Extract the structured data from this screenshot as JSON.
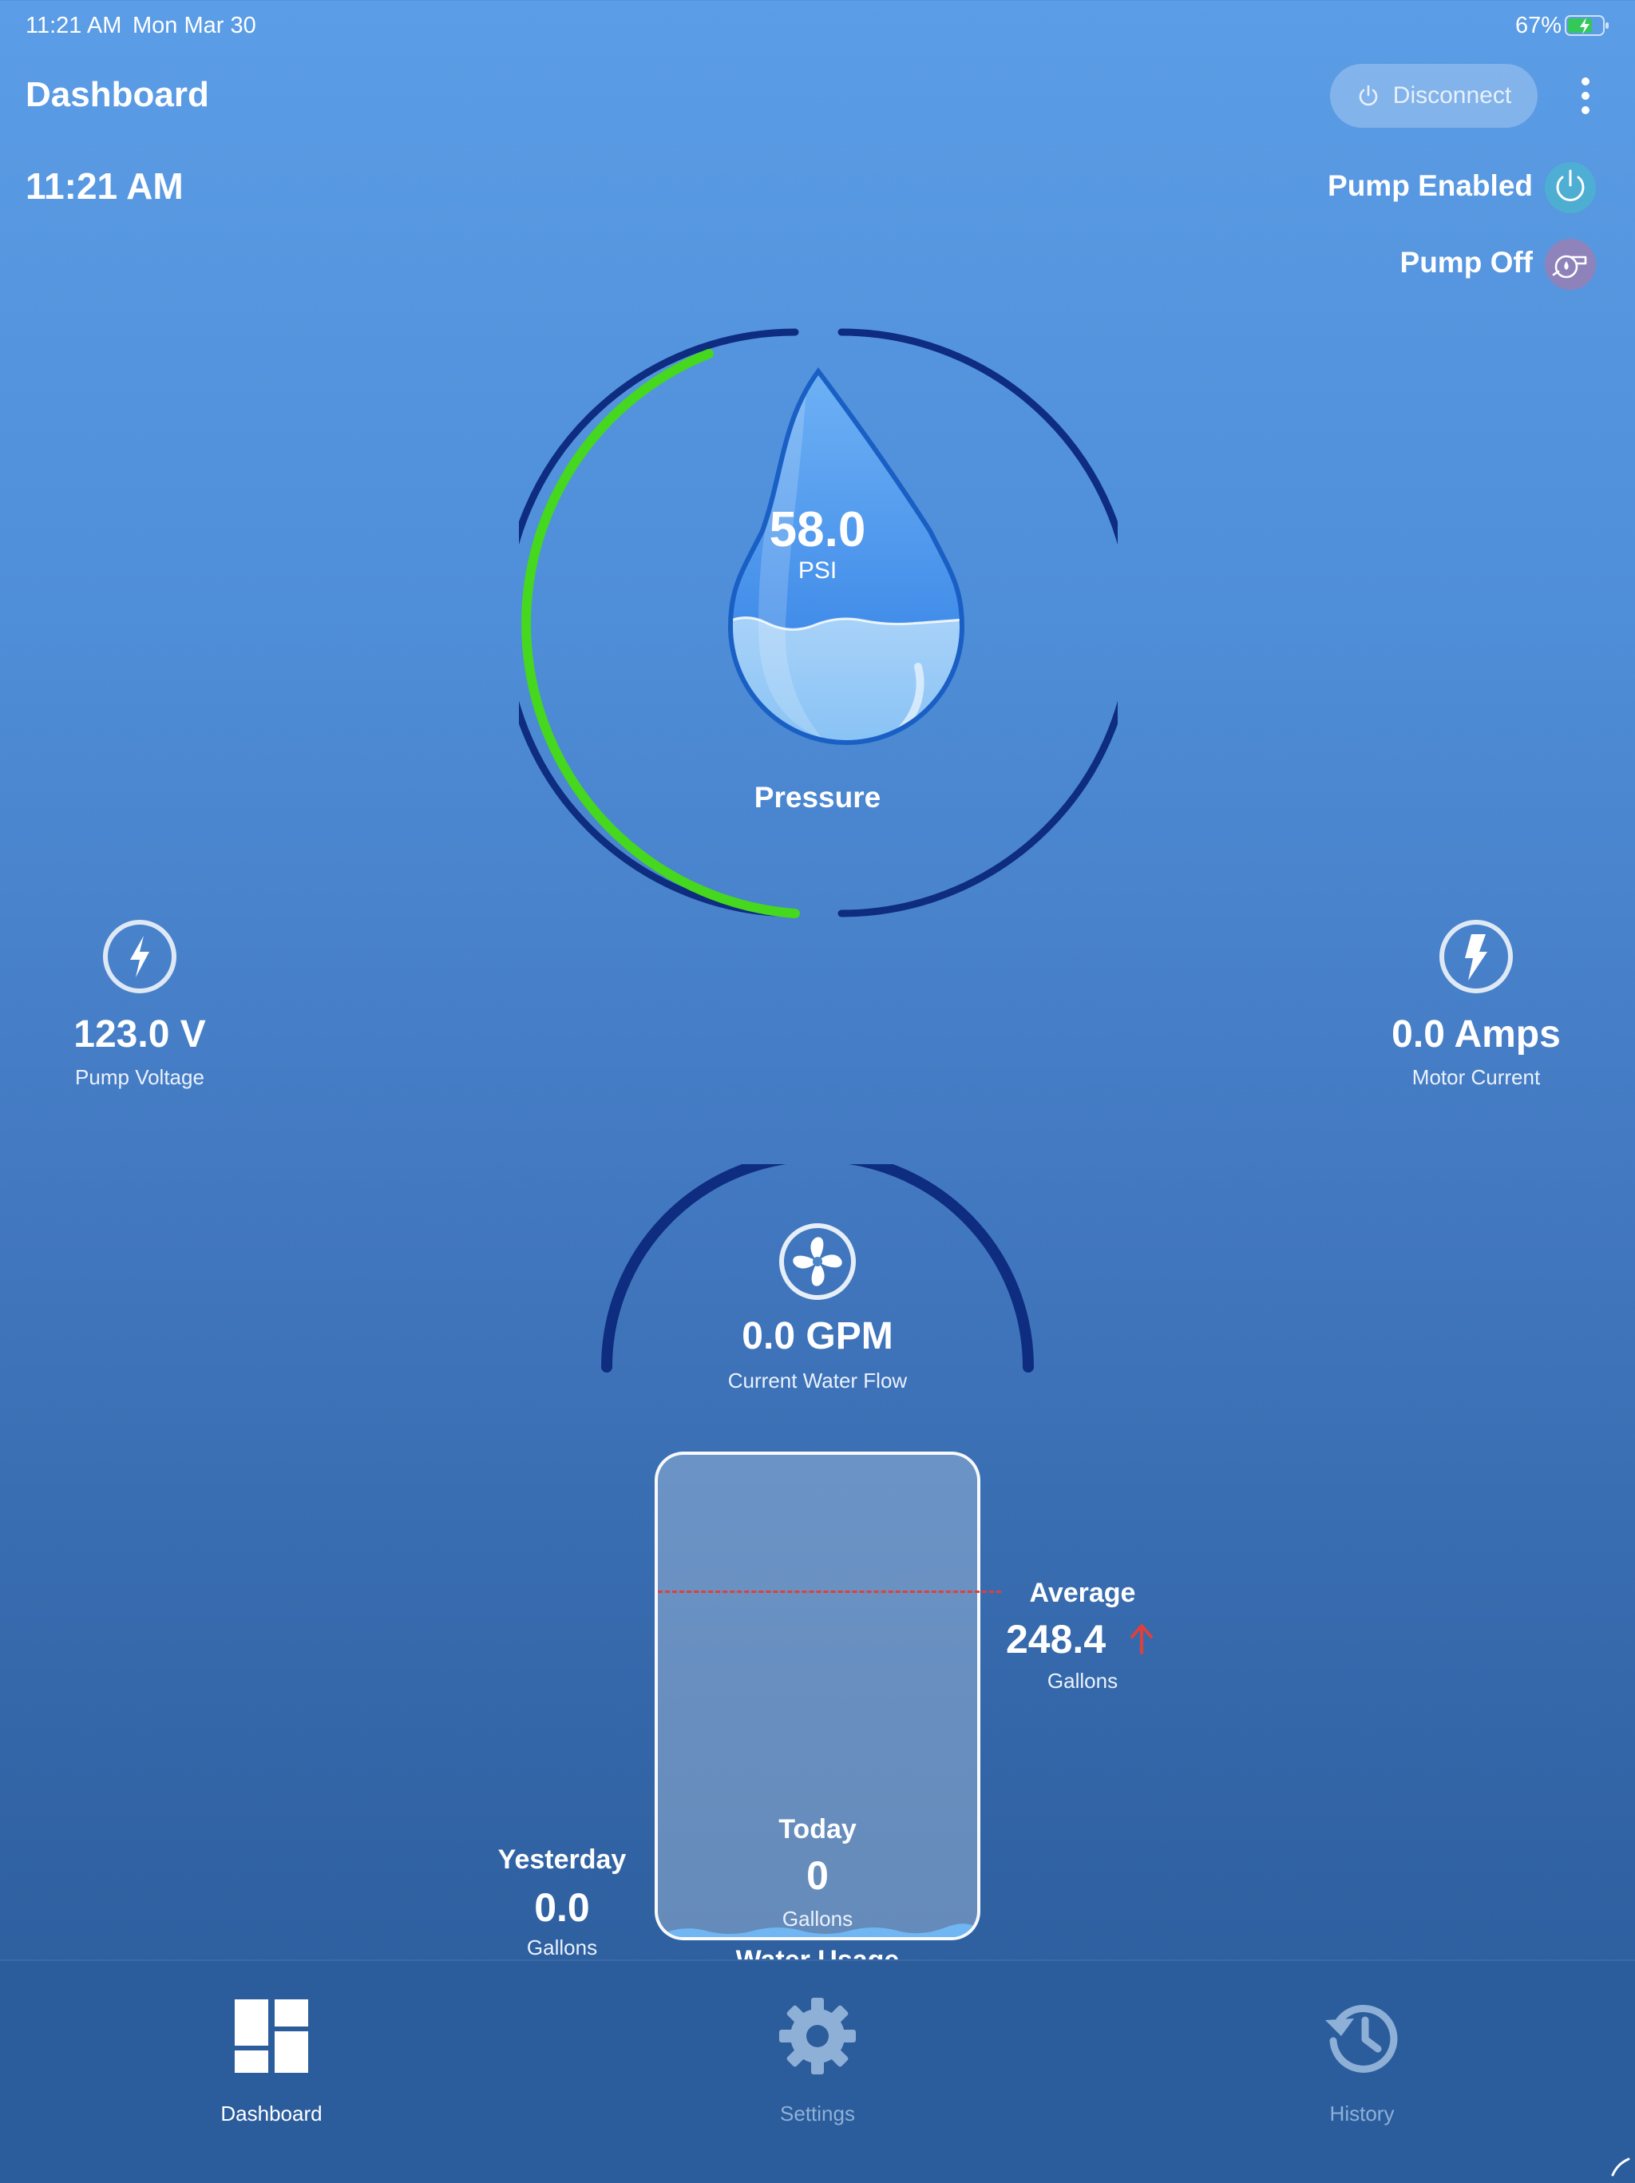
{
  "status_bar": {
    "time": "11:21 AM",
    "date": "Mon Mar 30",
    "battery": "67%",
    "icons": [
      "battery-charging-icon"
    ]
  },
  "header": {
    "title": "Dashboard",
    "disconnect_label": "Disconnect",
    "icons": [
      "power-icon",
      "more-vertical-icon"
    ]
  },
  "clock": "11:21 AM",
  "pump_status": {
    "enabled_label": "Pump Enabled",
    "off_label": "Pump Off",
    "enabled_color": "#3fd6b8",
    "off_color": "#d46a8e"
  },
  "pressure": {
    "value": "58.0",
    "unit": "PSI",
    "label": "Pressure",
    "gauge_fraction": 0.36,
    "progress_color": "#45d81e",
    "track_color": "#0e2c80"
  },
  "pump_voltage": {
    "value": "123.0 V",
    "label": "Pump Voltage"
  },
  "motor_current": {
    "value": "0.0 Amps",
    "label": "Motor Current"
  },
  "water_flow": {
    "value": "0.0 GPM",
    "label": "Current Water Flow"
  },
  "water_usage": {
    "title": "Water Usage",
    "average_title": "Average",
    "average_value": "248.4",
    "average_unit": "Gallons",
    "today_title": "Today",
    "today_value": "0",
    "today_unit": "Gallons",
    "yesterday_title": "Yesterday",
    "yesterday_value": "0.0",
    "yesterday_unit": "Gallons",
    "average_line_color": "#e0403a"
  },
  "tabs": [
    {
      "label": "Dashboard",
      "icon": "dashboard-icon",
      "active": true
    },
    {
      "label": "Settings",
      "icon": "gear-icon",
      "active": false
    },
    {
      "label": "History",
      "icon": "history-icon",
      "active": false
    }
  ]
}
